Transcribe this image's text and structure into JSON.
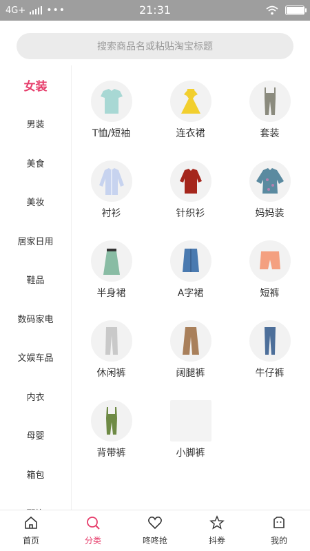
{
  "status_bar": {
    "network": "4G+",
    "time": "21:31",
    "battery_level": 1.0
  },
  "search": {
    "placeholder": "搜索商品名或粘贴淘宝标题"
  },
  "sidebar": {
    "items": [
      {
        "label": "女装",
        "active": true
      },
      {
        "label": "男装"
      },
      {
        "label": "美食"
      },
      {
        "label": "美妆"
      },
      {
        "label": "居家日用"
      },
      {
        "label": "鞋品"
      },
      {
        "label": "数码家电"
      },
      {
        "label": "文娱车品"
      },
      {
        "label": "内衣"
      },
      {
        "label": "母婴"
      },
      {
        "label": "箱包"
      },
      {
        "label": "配饰"
      }
    ]
  },
  "categories": [
    {
      "label": "T恤/短袖",
      "icon": "tshirt-icon",
      "color": "#a8d8d4"
    },
    {
      "label": "连衣裙",
      "icon": "dress-icon",
      "color": "#f2cf2e"
    },
    {
      "label": "套装",
      "icon": "overall-set-icon",
      "color": "#8b8b7e"
    },
    {
      "label": "衬衫",
      "icon": "shirt-icon",
      "color": "#c7d3ef"
    },
    {
      "label": "针织衫",
      "icon": "knit-sweater-icon",
      "color": "#a5261c"
    },
    {
      "label": "妈妈装",
      "icon": "mom-blouse-icon",
      "color": "#5a8aa0"
    },
    {
      "label": "半身裙",
      "icon": "skirt-icon",
      "color": "#89bca4"
    },
    {
      "label": "A字裙",
      "icon": "denim-skirt-icon",
      "color": "#4a7ab0"
    },
    {
      "label": "短裤",
      "icon": "shorts-icon",
      "color": "#f4a080"
    },
    {
      "label": "休闲裤",
      "icon": "casual-pants-icon",
      "color": "#c9c9c9"
    },
    {
      "label": "阔腿裤",
      "icon": "wide-leg-pants-icon",
      "color": "#a9805b"
    },
    {
      "label": "牛仔裤",
      "icon": "jeans-icon",
      "color": "#4d6f9a"
    },
    {
      "label": "背带裤",
      "icon": "overalls-icon",
      "color": "#6e8a45"
    },
    {
      "label": "小脚裤",
      "icon": "skinny-pants-icon",
      "color": "#f3f3f3"
    }
  ],
  "bottom_nav": [
    {
      "label": "首页",
      "icon": "home-icon"
    },
    {
      "label": "分类",
      "icon": "category-search-icon",
      "active": true
    },
    {
      "label": "咚咚抢",
      "icon": "heart-icon"
    },
    {
      "label": "抖券",
      "icon": "star-icon"
    },
    {
      "label": "我的",
      "icon": "profile-icon"
    }
  ],
  "colors": {
    "accent": "#e63d6b",
    "status_bar": "#9e9e9e",
    "search_bg": "#ebebeb"
  }
}
